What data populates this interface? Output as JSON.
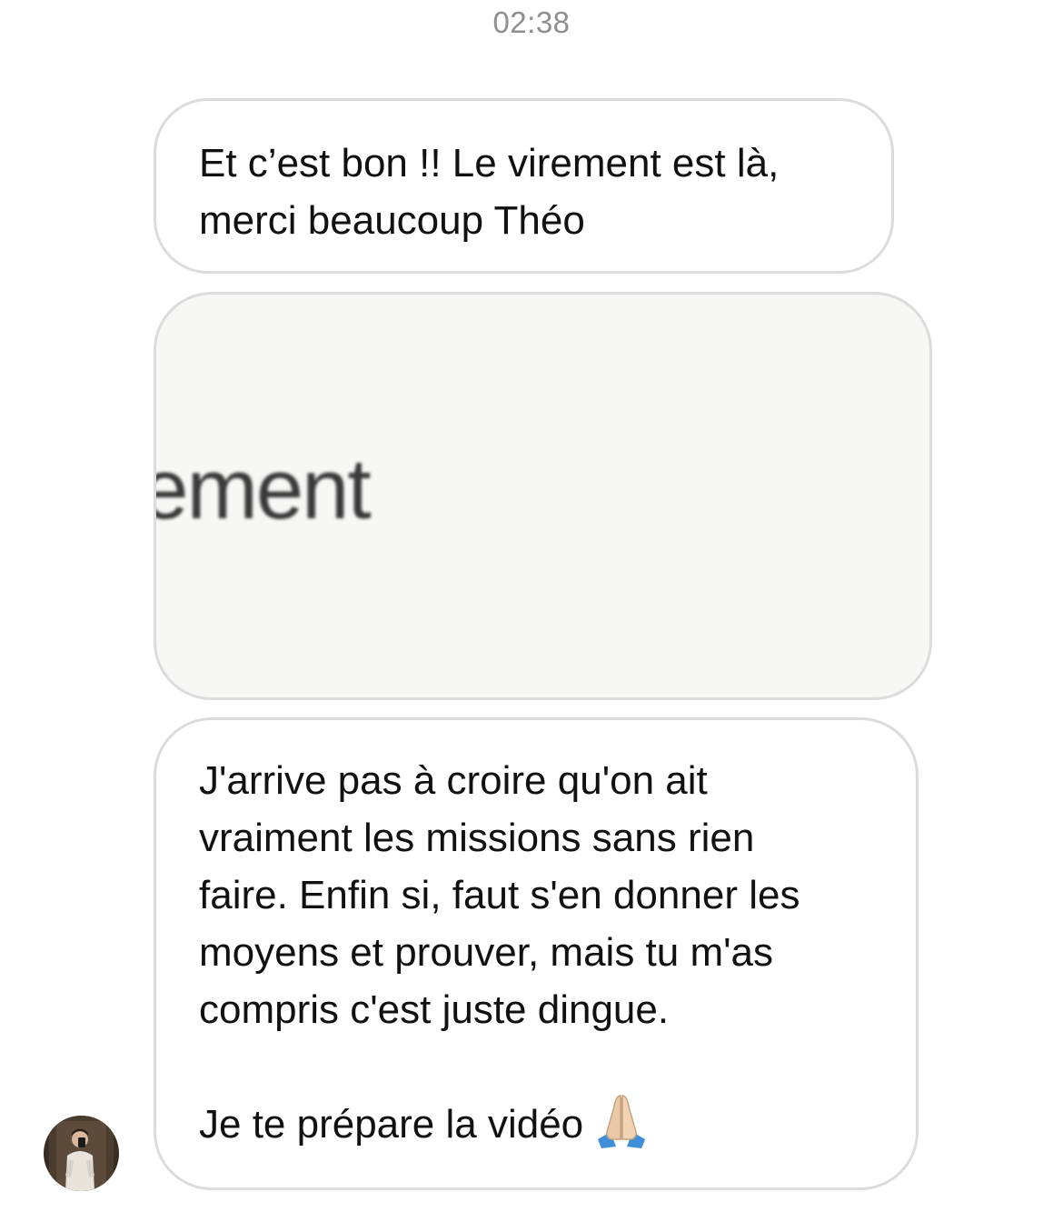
{
  "conversation": {
    "timestamp": "02:38",
    "messages": [
      {
        "type": "text",
        "lines": [
          "Et c’est bon !! Le virement est là,",
          "merci beaucoup Théo"
        ]
      },
      {
        "type": "image",
        "visible_text": "rement"
      },
      {
        "type": "text",
        "paragraph_1": [
          "J'arrive pas à croire qu'on ait",
          "vraiment les missions sans rien",
          "faire. Enfin si, faut s'en donner les",
          "moyens et prouver, mais tu m'as",
          "compris c'est juste dingue."
        ],
        "paragraph_2": "Je te prépare la vidéo",
        "emoji": "folded-hands-icon"
      }
    ]
  },
  "colors": {
    "bubble_border": "#dcdcdc",
    "timestamp": "#8e8e93",
    "image_background": "#f7f7f5"
  }
}
